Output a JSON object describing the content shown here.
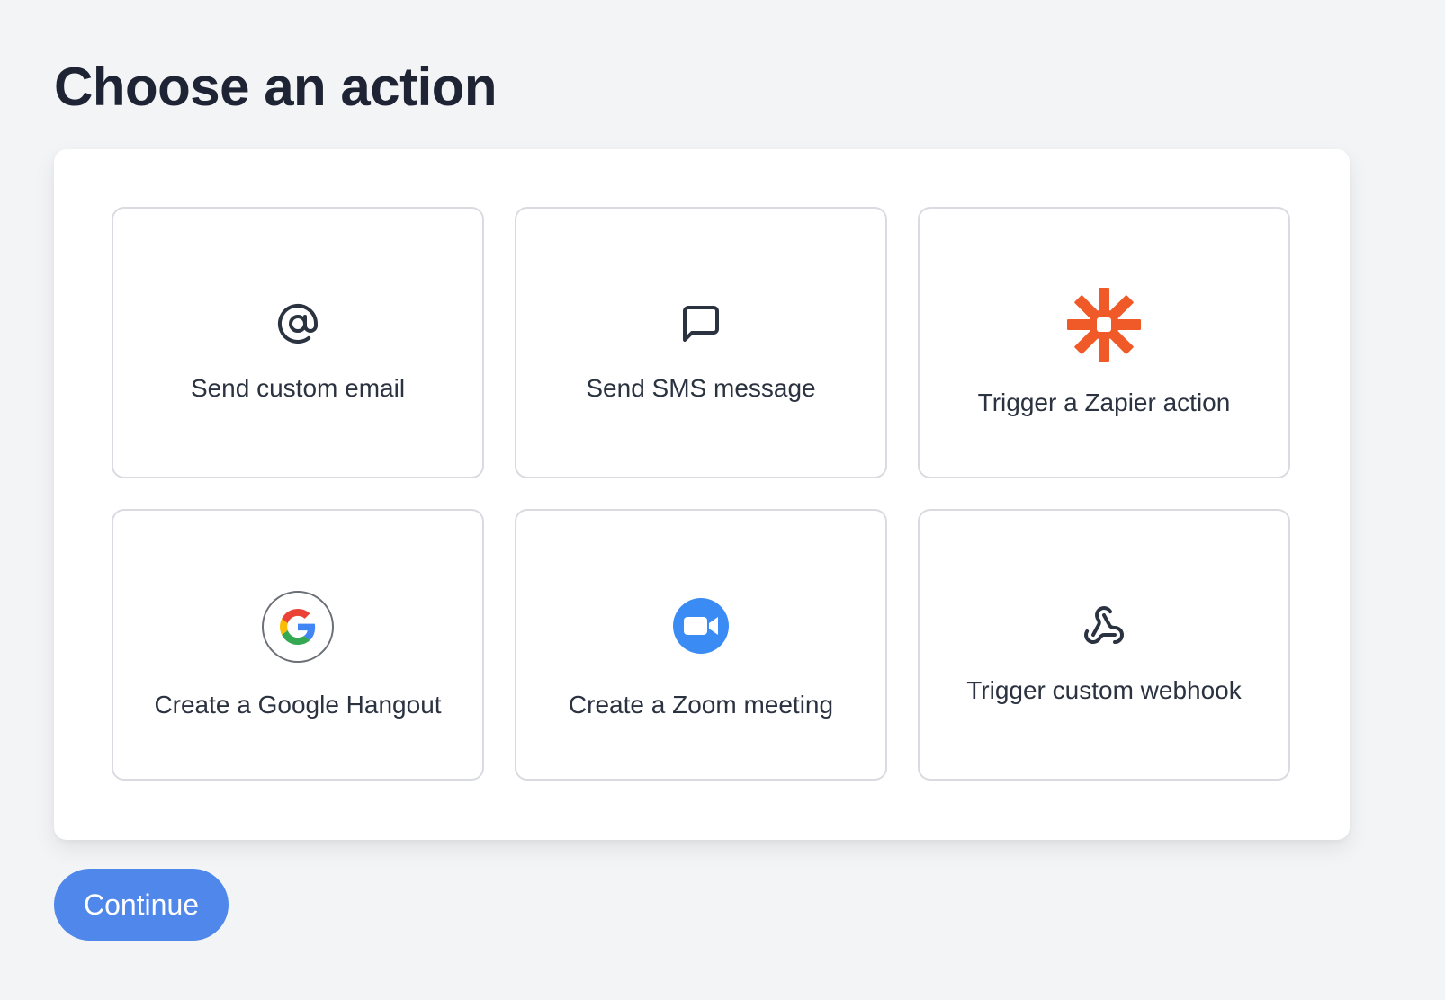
{
  "page": {
    "title": "Choose an action"
  },
  "actions": [
    {
      "label": "Send custom email",
      "icon": "at-sign-icon"
    },
    {
      "label": "Send SMS message",
      "icon": "message-square-icon"
    },
    {
      "label": "Trigger a Zapier action",
      "icon": "zapier-logo-icon"
    },
    {
      "label": "Create a Google Hangout",
      "icon": "google-logo-icon"
    },
    {
      "label": "Create a Zoom meeting",
      "icon": "zoom-logo-icon"
    },
    {
      "label": "Trigger custom webhook",
      "icon": "webhook-icon"
    }
  ],
  "footer": {
    "continue_label": "Continue"
  },
  "colors": {
    "background": "#f3f4f6",
    "primary_button": "#4f87ea",
    "zapier_orange": "#f05a28",
    "zoom_blue": "#3b8bf5"
  }
}
